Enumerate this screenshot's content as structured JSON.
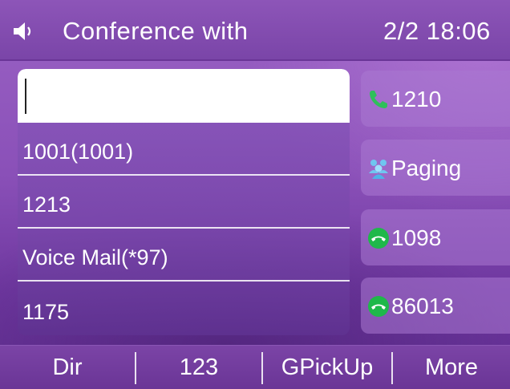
{
  "status_bar": {
    "title": "Conference with",
    "datetime": "2/2 18:06",
    "icon": "speaker-icon"
  },
  "search": {
    "value": "",
    "placeholder": ""
  },
  "contacts": [
    {
      "label": "1001(1001)"
    },
    {
      "label": "1213"
    },
    {
      "label": "Voice Mail(*97)"
    },
    {
      "label": "1175"
    }
  ],
  "line_keys": [
    {
      "label": "1210",
      "icon": "handset-icon",
      "color": "#2ec05a"
    },
    {
      "label": "Paging",
      "icon": "paging-group-icon",
      "color": "#6fc6f0"
    },
    {
      "label": "1098",
      "icon": "hangup-icon",
      "color": "#1fb84a"
    },
    {
      "label": "86013",
      "icon": "hangup-icon",
      "color": "#1fb84a"
    }
  ],
  "softkeys": [
    {
      "label": "Dir"
    },
    {
      "label": "123"
    },
    {
      "label": "GPickUp"
    },
    {
      "label": "More"
    }
  ],
  "colors": {
    "background": "#8a50b8",
    "status_bar": "#7a45a8",
    "softkey_bar": "#6a3596"
  }
}
